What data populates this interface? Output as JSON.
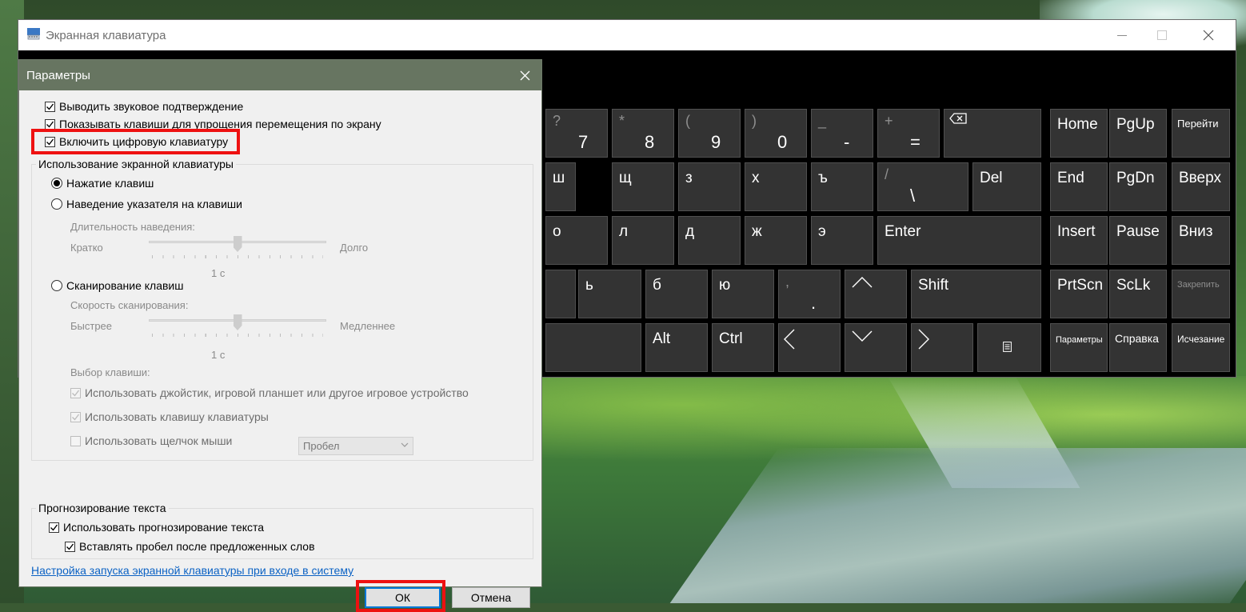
{
  "window": {
    "title": "Экранная клавиатура",
    "controls": {
      "minimize": "min",
      "maximize": "max",
      "close": "×"
    }
  },
  "keyboard": {
    "row1": [
      {
        "sub": "?",
        "low": "7"
      },
      {
        "sub": "*",
        "low": "8"
      },
      {
        "sub": "(",
        "low": "9"
      },
      {
        "sub": ")",
        "low": "0"
      },
      {
        "sub": "_",
        "low": "-"
      },
      {
        "sub": "+",
        "low": "="
      }
    ],
    "row2": [
      "ш",
      "щ",
      "з",
      "х",
      "ъ"
    ],
    "slash": {
      "sub": "/",
      "low": "\\"
    },
    "row3": [
      "о",
      "л",
      "д",
      "ж",
      "э"
    ],
    "row4": [
      "ь",
      "б",
      "ю"
    ],
    "comma": {
      "sub": ",",
      "low": "."
    },
    "special": {
      "del": "Del",
      "enter": "Enter",
      "shift": "Shift",
      "alt": "Alt",
      "ctrl": "Ctrl"
    },
    "nav": [
      [
        "Home",
        "PgUp",
        "Перейти"
      ],
      [
        "End",
        "PgDn",
        "Вверх"
      ],
      [
        "Insert",
        "Pause",
        "Вниз"
      ],
      [
        "PrtScn",
        "ScLk",
        "Закрепить"
      ],
      [
        "Параметры",
        "Справка",
        "Исчезание"
      ]
    ]
  },
  "dialog": {
    "title": "Параметры",
    "checkboxes_top": [
      "Выводить звуковое подтверждение",
      "Показывать клавиши для упрощения перемещения по экрану",
      "Включить цифровую клавиатуру"
    ],
    "usage_group": {
      "label": "Использование экранной клавиатуры",
      "radio_press": "Нажатие клавиш",
      "radio_hover": "Наведение указателя на клавиши",
      "hover_duration_label": "Длительность наведения:",
      "hover_short": "Кратко",
      "hover_long": "Долго",
      "hover_value": "1 с",
      "hover_slider_fraction": 0.5,
      "radio_scan": "Сканирование клавиш",
      "scan_speed_label": "Скорость сканирования:",
      "scan_fast": "Быстрее",
      "scan_slow": "Медленнее",
      "scan_value": "1 с",
      "scan_slider_fraction": 0.5,
      "key_select_label": "Выбор клавиши:",
      "cb_joystick": "Использовать джойстик, игровой планшет или другое игровое устройство",
      "cb_keyboard_key": "Использовать клавишу клавиатуры",
      "key_dropdown": "Пробел",
      "cb_mouse": "Использовать щелчок мыши"
    },
    "prediction_group": {
      "label": "Прогнозирование текста",
      "cb_use": "Использовать прогнозирование текста",
      "cb_space": "Вставлять пробел после предложенных слов"
    },
    "link": "Настройка запуска экранной клавиатуры при входе в систему",
    "ok": "ОК",
    "cancel": "Отмена"
  },
  "colors": {
    "highlight": "#ee1111",
    "dialog_titlebar": "#677561",
    "key_bg": "#333333",
    "link": "#0b62c4"
  }
}
